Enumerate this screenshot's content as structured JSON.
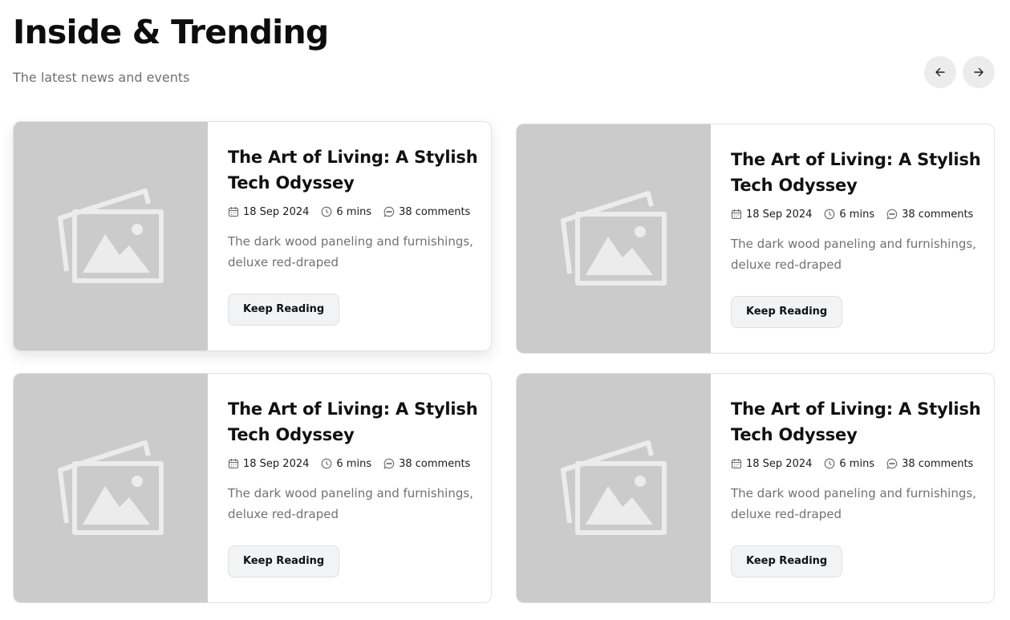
{
  "header": {
    "title": "Inside & Trending",
    "subtitle": "The latest news and events",
    "prev_icon": "arrow-left-icon",
    "next_icon": "arrow-right-icon"
  },
  "colors": {
    "image_placeholder": "#cbcbcb",
    "button_bg": "#f2f3f4",
    "muted_text": "#727272"
  },
  "cards": [
    {
      "title": "The Art of Living: A Stylish Tech Odyssey",
      "date": "18 Sep 2024",
      "read_time": "6 mins",
      "comments": "38 comments",
      "excerpt": "The dark wood paneling and furnishings, deluxe red-draped",
      "button_label": "Keep Reading"
    },
    {
      "title": "The Art of Living: A Stylish Tech Odyssey",
      "date": "18 Sep 2024",
      "read_time": "6 mins",
      "comments": "38 comments",
      "excerpt": "The dark wood paneling and furnishings, deluxe red-draped",
      "button_label": "Keep Reading"
    },
    {
      "title": "The Art of Living: A Stylish Tech Odyssey",
      "date": "18 Sep 2024",
      "read_time": "6 mins",
      "comments": "38 comments",
      "excerpt": "The dark wood paneling and furnishings, deluxe red-draped",
      "button_label": "Keep Reading"
    },
    {
      "title": "The Art of Living: A Stylish Tech Odyssey",
      "date": "18 Sep 2024",
      "read_time": "6 mins",
      "comments": "38 comments",
      "excerpt": "The dark wood paneling and furnishings, deluxe red-draped",
      "button_label": "Keep Reading"
    }
  ]
}
